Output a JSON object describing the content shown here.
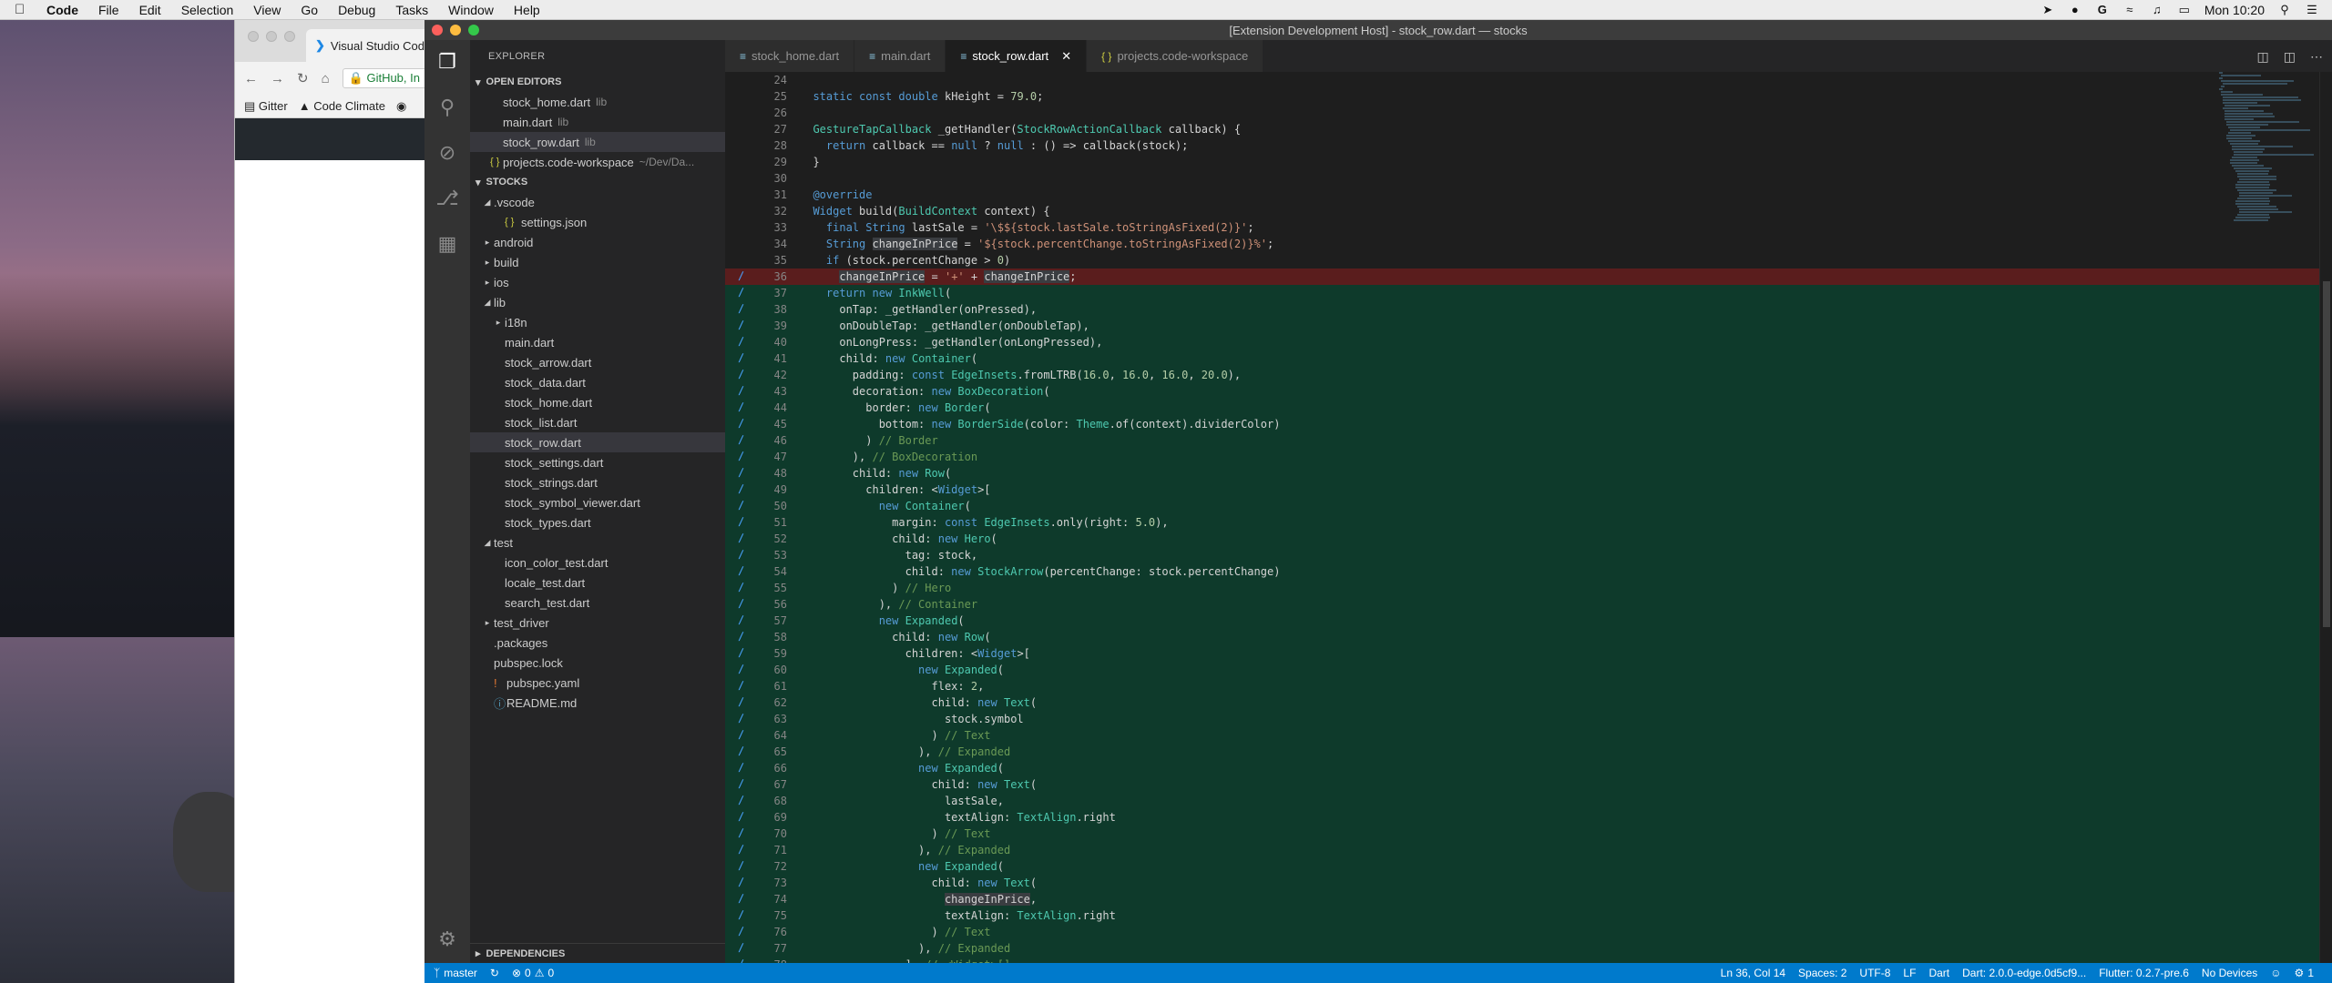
{
  "menubar": {
    "app": "Code",
    "items": [
      "File",
      "Edit",
      "Selection",
      "View",
      "Go",
      "Debug",
      "Tasks",
      "Window",
      "Help"
    ],
    "clock": "Mon 10:20"
  },
  "chrome": {
    "tab_title": "Visual Studio Cod",
    "url_text": "GitHub, In",
    "bookmarks": [
      "Gitter",
      "Code Climate"
    ]
  },
  "window": {
    "title": "[Extension Development Host] - stock_row.dart — stocks"
  },
  "sidebar": {
    "title": "EXPLORER",
    "open_editors_label": "OPEN EDITORS",
    "open_editors": [
      {
        "name": "stock_home.dart",
        "desc": "lib"
      },
      {
        "name": "main.dart",
        "desc": "lib"
      },
      {
        "name": "stock_row.dart",
        "desc": "lib"
      },
      {
        "name": "projects.code-workspace",
        "desc": "~/Dev/Da..."
      }
    ],
    "project_label": "STOCKS",
    "tree": [
      {
        "name": ".vscode",
        "indent": 1,
        "twist": "open"
      },
      {
        "name": "settings.json",
        "indent": 2,
        "icon": "json"
      },
      {
        "name": "android",
        "indent": 1,
        "twist": "closed"
      },
      {
        "name": "build",
        "indent": 1,
        "twist": "closed"
      },
      {
        "name": "ios",
        "indent": 1,
        "twist": "closed"
      },
      {
        "name": "lib",
        "indent": 1,
        "twist": "open"
      },
      {
        "name": "i18n",
        "indent": 2,
        "twist": "closed"
      },
      {
        "name": "main.dart",
        "indent": 2
      },
      {
        "name": "stock_arrow.dart",
        "indent": 2
      },
      {
        "name": "stock_data.dart",
        "indent": 2
      },
      {
        "name": "stock_home.dart",
        "indent": 2
      },
      {
        "name": "stock_list.dart",
        "indent": 2
      },
      {
        "name": "stock_row.dart",
        "indent": 2,
        "selected": true
      },
      {
        "name": "stock_settings.dart",
        "indent": 2
      },
      {
        "name": "stock_strings.dart",
        "indent": 2
      },
      {
        "name": "stock_symbol_viewer.dart",
        "indent": 2
      },
      {
        "name": "stock_types.dart",
        "indent": 2
      },
      {
        "name": "test",
        "indent": 1,
        "twist": "open"
      },
      {
        "name": "icon_color_test.dart",
        "indent": 2
      },
      {
        "name": "locale_test.dart",
        "indent": 2
      },
      {
        "name": "search_test.dart",
        "indent": 2
      },
      {
        "name": "test_driver",
        "indent": 1,
        "twist": "closed"
      },
      {
        "name": ".packages",
        "indent": 1
      },
      {
        "name": "pubspec.lock",
        "indent": 1
      },
      {
        "name": "pubspec.yaml",
        "indent": 1,
        "icon": "warn"
      },
      {
        "name": "README.md",
        "indent": 1,
        "icon": "info"
      }
    ],
    "dependencies_label": "DEPENDENCIES"
  },
  "tabs": [
    {
      "label": "stock_home.dart",
      "active": false,
      "icon": "dart"
    },
    {
      "label": "main.dart",
      "active": false,
      "icon": "dart"
    },
    {
      "label": "stock_row.dart",
      "active": true,
      "icon": "dart"
    },
    {
      "label": "projects.code-workspace",
      "active": false,
      "icon": "ws"
    }
  ],
  "code": [
    {
      "n": 24,
      "t": ""
    },
    {
      "n": 25,
      "t": "  static const double kHeight = 79.0;"
    },
    {
      "n": 26,
      "t": ""
    },
    {
      "n": 27,
      "t": "  GestureTapCallback _getHandler(StockRowActionCallback callback) {"
    },
    {
      "n": 28,
      "t": "    return callback == null ? null : () => callback(stock);"
    },
    {
      "n": 29,
      "t": "  }"
    },
    {
      "n": 30,
      "t": ""
    },
    {
      "n": 31,
      "t": "  @override"
    },
    {
      "n": 32,
      "t": "  Widget build(BuildContext context) {"
    },
    {
      "n": 33,
      "t": "    final String lastSale = '\\$${stock.lastSale.toStringAsFixed(2)}';"
    },
    {
      "n": 34,
      "t": "    String changeInPrice = '${stock.percentChange.toStringAsFixed(2)}%';"
    },
    {
      "n": 35,
      "t": "    if (stock.percentChange > 0)"
    },
    {
      "n": 36,
      "t": "      changeInPrice = '+' + changeInPrice;",
      "diff": "rem"
    },
    {
      "n": 37,
      "t": "    return new InkWell(",
      "diff": "add"
    },
    {
      "n": 38,
      "t": "      onTap: _getHandler(onPressed),",
      "diff": "add"
    },
    {
      "n": 39,
      "t": "      onDoubleTap: _getHandler(onDoubleTap),",
      "diff": "add"
    },
    {
      "n": 40,
      "t": "      onLongPress: _getHandler(onLongPressed),",
      "diff": "add"
    },
    {
      "n": 41,
      "t": "      child: new Container(",
      "diff": "add"
    },
    {
      "n": 42,
      "t": "        padding: const EdgeInsets.fromLTRB(16.0, 16.0, 16.0, 20.0),",
      "diff": "add"
    },
    {
      "n": 43,
      "t": "        decoration: new BoxDecoration(",
      "diff": "add"
    },
    {
      "n": 44,
      "t": "          border: new Border(",
      "diff": "add"
    },
    {
      "n": 45,
      "t": "            bottom: new BorderSide(color: Theme.of(context).dividerColor)",
      "diff": "add"
    },
    {
      "n": 46,
      "t": "          ) // Border",
      "diff": "add"
    },
    {
      "n": 47,
      "t": "        ), // BoxDecoration",
      "diff": "add"
    },
    {
      "n": 48,
      "t": "        child: new Row(",
      "diff": "add"
    },
    {
      "n": 49,
      "t": "          children: <Widget>[",
      "diff": "add"
    },
    {
      "n": 50,
      "t": "            new Container(",
      "diff": "add"
    },
    {
      "n": 51,
      "t": "              margin: const EdgeInsets.only(right: 5.0),",
      "diff": "add"
    },
    {
      "n": 52,
      "t": "              child: new Hero(",
      "diff": "add"
    },
    {
      "n": 53,
      "t": "                tag: stock,",
      "diff": "add"
    },
    {
      "n": 54,
      "t": "                child: new StockArrow(percentChange: stock.percentChange)",
      "diff": "add"
    },
    {
      "n": 55,
      "t": "              ) // Hero",
      "diff": "add"
    },
    {
      "n": 56,
      "t": "            ), // Container",
      "diff": "add"
    },
    {
      "n": 57,
      "t": "            new Expanded(",
      "diff": "add"
    },
    {
      "n": 58,
      "t": "              child: new Row(",
      "diff": "add"
    },
    {
      "n": 59,
      "t": "                children: <Widget>[",
      "diff": "add"
    },
    {
      "n": 60,
      "t": "                  new Expanded(",
      "diff": "add"
    },
    {
      "n": 61,
      "t": "                    flex: 2,",
      "diff": "add"
    },
    {
      "n": 62,
      "t": "                    child: new Text(",
      "diff": "add"
    },
    {
      "n": 63,
      "t": "                      stock.symbol",
      "diff": "add"
    },
    {
      "n": 64,
      "t": "                    ) // Text",
      "diff": "add"
    },
    {
      "n": 65,
      "t": "                  ), // Expanded",
      "diff": "add"
    },
    {
      "n": 66,
      "t": "                  new Expanded(",
      "diff": "add"
    },
    {
      "n": 67,
      "t": "                    child: new Text(",
      "diff": "add"
    },
    {
      "n": 68,
      "t": "                      lastSale,",
      "diff": "add"
    },
    {
      "n": 69,
      "t": "                      textAlign: TextAlign.right",
      "diff": "add"
    },
    {
      "n": 70,
      "t": "                    ) // Text",
      "diff": "add"
    },
    {
      "n": 71,
      "t": "                  ), // Expanded",
      "diff": "add"
    },
    {
      "n": 72,
      "t": "                  new Expanded(",
      "diff": "add"
    },
    {
      "n": 73,
      "t": "                    child: new Text(",
      "diff": "add"
    },
    {
      "n": 74,
      "t": "                      changeInPrice,",
      "diff": "add"
    },
    {
      "n": 75,
      "t": "                      textAlign: TextAlign.right",
      "diff": "add"
    },
    {
      "n": 76,
      "t": "                    ) // Text",
      "diff": "add"
    },
    {
      "n": 77,
      "t": "                  ), // Expanded",
      "diff": "add"
    },
    {
      "n": 78,
      "t": "                ], // <Widget>[]",
      "diff": "add"
    }
  ],
  "statusbar": {
    "branch": "master",
    "errors": "0",
    "warnings": "0",
    "cursor": "Ln 36, Col 14",
    "spaces": "Spaces: 2",
    "encoding": "UTF-8",
    "eol": "LF",
    "language": "Dart",
    "dart_version": "Dart: 2.0.0-edge.0d5cf9...",
    "flutter_version": "Flutter: 0.2.7-pre.6",
    "devices": "No Devices",
    "notifications": "1"
  },
  "colors": {
    "statusbar": "#007acc",
    "added_line": "#0e3a2b",
    "removed_line": "#5a1d1d",
    "activitybar": "#333333",
    "sidebar": "#252526",
    "editor": "#1e1e1e"
  }
}
